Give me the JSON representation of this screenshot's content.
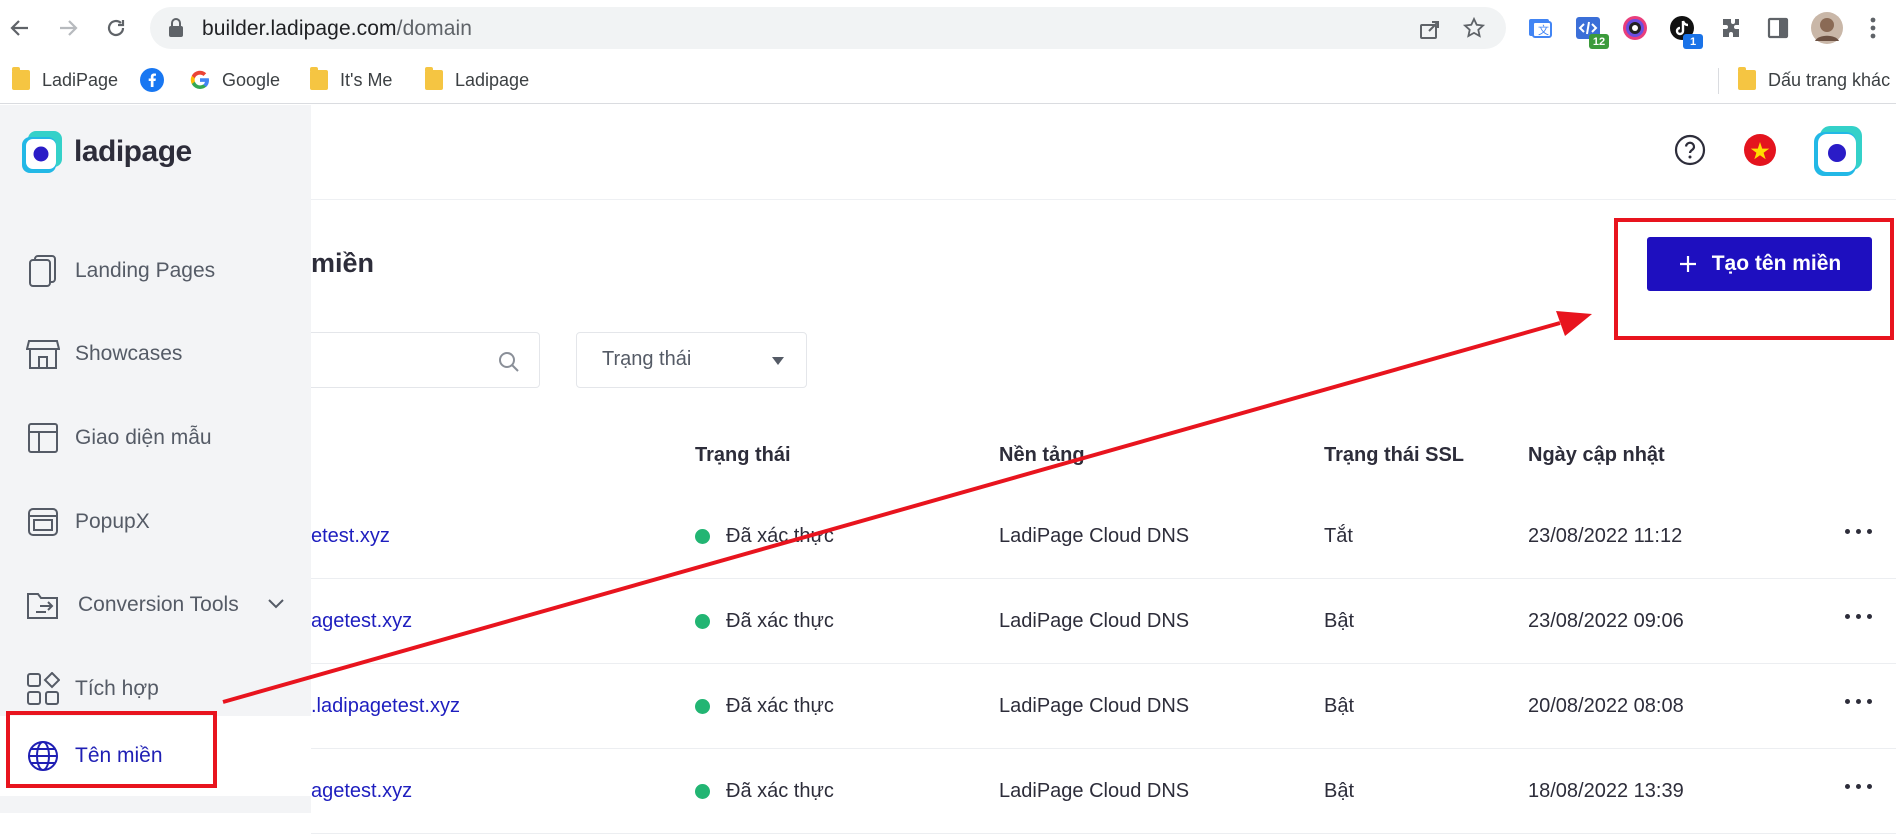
{
  "browser": {
    "url_host": "builder.ladipage.com",
    "url_path": "/domain",
    "extensions": [
      {
        "name": "translate-extension-icon",
        "badge": ""
      },
      {
        "name": "code-extension-icon",
        "badge": "12"
      },
      {
        "name": "color-extension-icon",
        "badge": ""
      },
      {
        "name": "tiktok-extension-icon",
        "badge": "1"
      }
    ],
    "bookmarks": [
      {
        "label": "LadiPage",
        "icon": "folder-icon"
      },
      {
        "label": "",
        "icon": "facebook-icon"
      },
      {
        "label": "Google",
        "icon": "google-icon"
      },
      {
        "label": "It's Me",
        "icon": "folder-icon"
      },
      {
        "label": "Ladipage",
        "icon": "folder-icon"
      }
    ],
    "other_bookmarks": "Dấu trang khác"
  },
  "sidebar": {
    "logo": "ladipage",
    "items": [
      {
        "label": "Landing Pages",
        "icon": "landing-pages-icon"
      },
      {
        "label": "Showcases",
        "icon": "store-icon"
      },
      {
        "label": "Giao diện mẫu",
        "icon": "template-icon"
      },
      {
        "label": "PopupX",
        "icon": "popup-icon"
      },
      {
        "label": "Conversion Tools",
        "icon": "conversion-tools-icon"
      },
      {
        "label": "Tích hợp",
        "icon": "integration-icon"
      },
      {
        "label": "Tên miền",
        "icon": "globe-icon",
        "active": true
      }
    ]
  },
  "header": {
    "help_icon": "help-icon",
    "language_flag": "vietnam-flag-icon"
  },
  "main": {
    "title": "miền",
    "create_button": "Tạo tên miền",
    "status_filter": "Trạng thái",
    "columns": [
      "Trạng thái",
      "Nền tảng",
      "Trạng thái SSL",
      "Ngày cập nhật"
    ],
    "rows": [
      {
        "domain": "etest.xyz",
        "status": "Đã xác thực",
        "platform": "LadiPage Cloud DNS",
        "ssl": "Tắt",
        "updated": "23/08/2022 11:12"
      },
      {
        "domain": "agetest.xyz",
        "status": "Đã xác thực",
        "platform": "LadiPage Cloud DNS",
        "ssl": "Bật",
        "updated": "23/08/2022 09:06"
      },
      {
        "domain": ".ladipagetest.xyz",
        "status": "Đã xác thực",
        "platform": "LadiPage Cloud DNS",
        "ssl": "Bật",
        "updated": "20/08/2022 08:08"
      },
      {
        "domain": "agetest.xyz",
        "status": "Đã xác thực",
        "platform": "LadiPage Cloud DNS",
        "ssl": "Bật",
        "updated": "18/08/2022 13:39"
      }
    ]
  },
  "colors": {
    "accent": "#1e0fbf",
    "link": "#1e1ebf",
    "verified": "#22b573",
    "annotation": "#e8141e"
  }
}
